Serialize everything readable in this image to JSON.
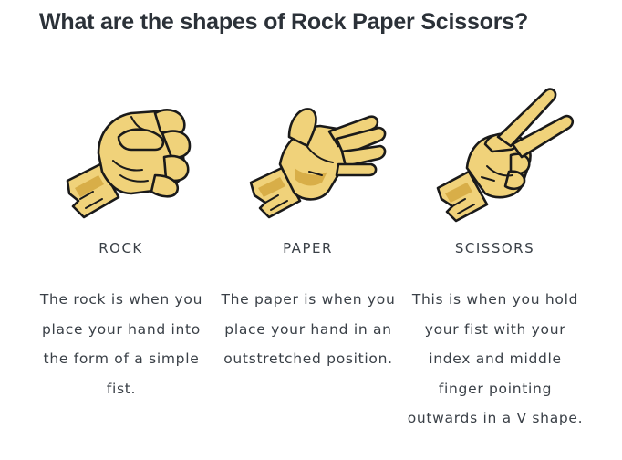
{
  "title": "What are the shapes of Rock Paper Scissors?",
  "shapes": [
    {
      "name": "ROCK",
      "icon": "rock-fist-icon",
      "description": "The rock is when you place your hand into the form of a simple fist."
    },
    {
      "name": "PAPER",
      "icon": "paper-open-hand-icon",
      "description": "The paper is when you place your hand in an outstretched position."
    },
    {
      "name": "SCISSORS",
      "icon": "scissors-v-sign-icon",
      "description": "This is when you hold your fist with your index and middle finger pointing outwards in a V shape."
    }
  ],
  "colors": {
    "skin": "#f0d27a",
    "skin_shade": "#d8ae48",
    "outline": "#1a1a1a",
    "text": "#3a4047",
    "title": "#2b3138"
  }
}
